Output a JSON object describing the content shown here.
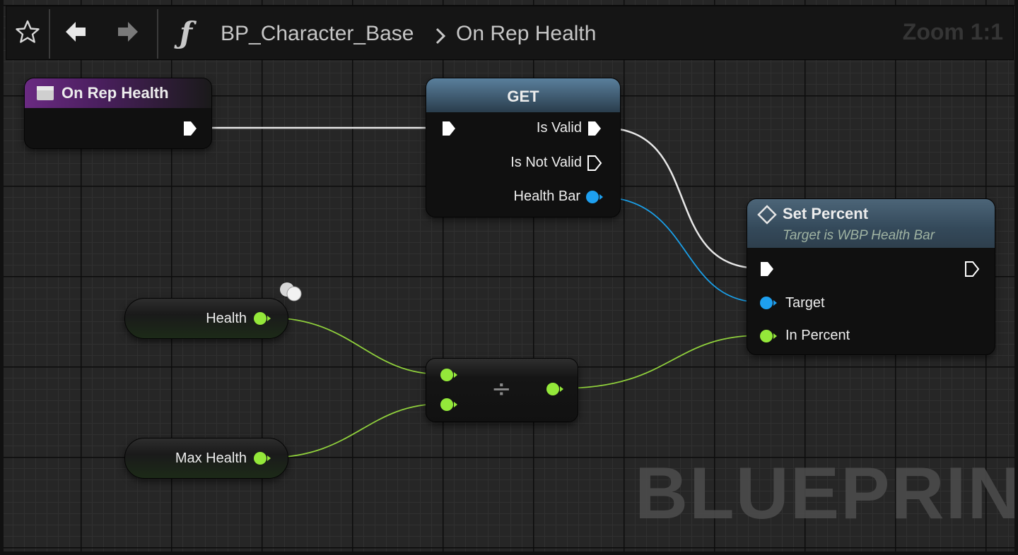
{
  "toolbar": {
    "favorite_icon": "star-icon",
    "back_icon": "arrow-left-icon",
    "forward_icon": "arrow-right-icon",
    "function_icon": "function-f-icon",
    "breadcrumb_root": "BP_Character_Base",
    "breadcrumb_leaf": "On Rep Health",
    "zoom": "Zoom 1:1"
  },
  "nodes": {
    "event": {
      "title": "On Rep Health",
      "icon": "event-icon",
      "color": "#6a2a82"
    },
    "get": {
      "title": "GET",
      "pins": {
        "is_valid": "Is Valid",
        "is_not_valid": "Is Not Valid",
        "health_bar": "Health Bar"
      },
      "color": "#5a7f9c"
    },
    "set_percent": {
      "title": "Set Percent",
      "subtitle": "Target is WBP Health Bar",
      "icon": "function-diamond-icon",
      "pins": {
        "target": "Target",
        "in_percent": "In Percent"
      },
      "color": "#4c6578"
    },
    "health": {
      "label": "Health"
    },
    "max_health": {
      "label": "Max Health"
    },
    "divide": {
      "symbol": "÷"
    }
  },
  "colors": {
    "exec": "#ffffff",
    "object_pin": "#1ea0f0",
    "float_pin": "#94e83a"
  },
  "watermark": "BLUEPRINT"
}
